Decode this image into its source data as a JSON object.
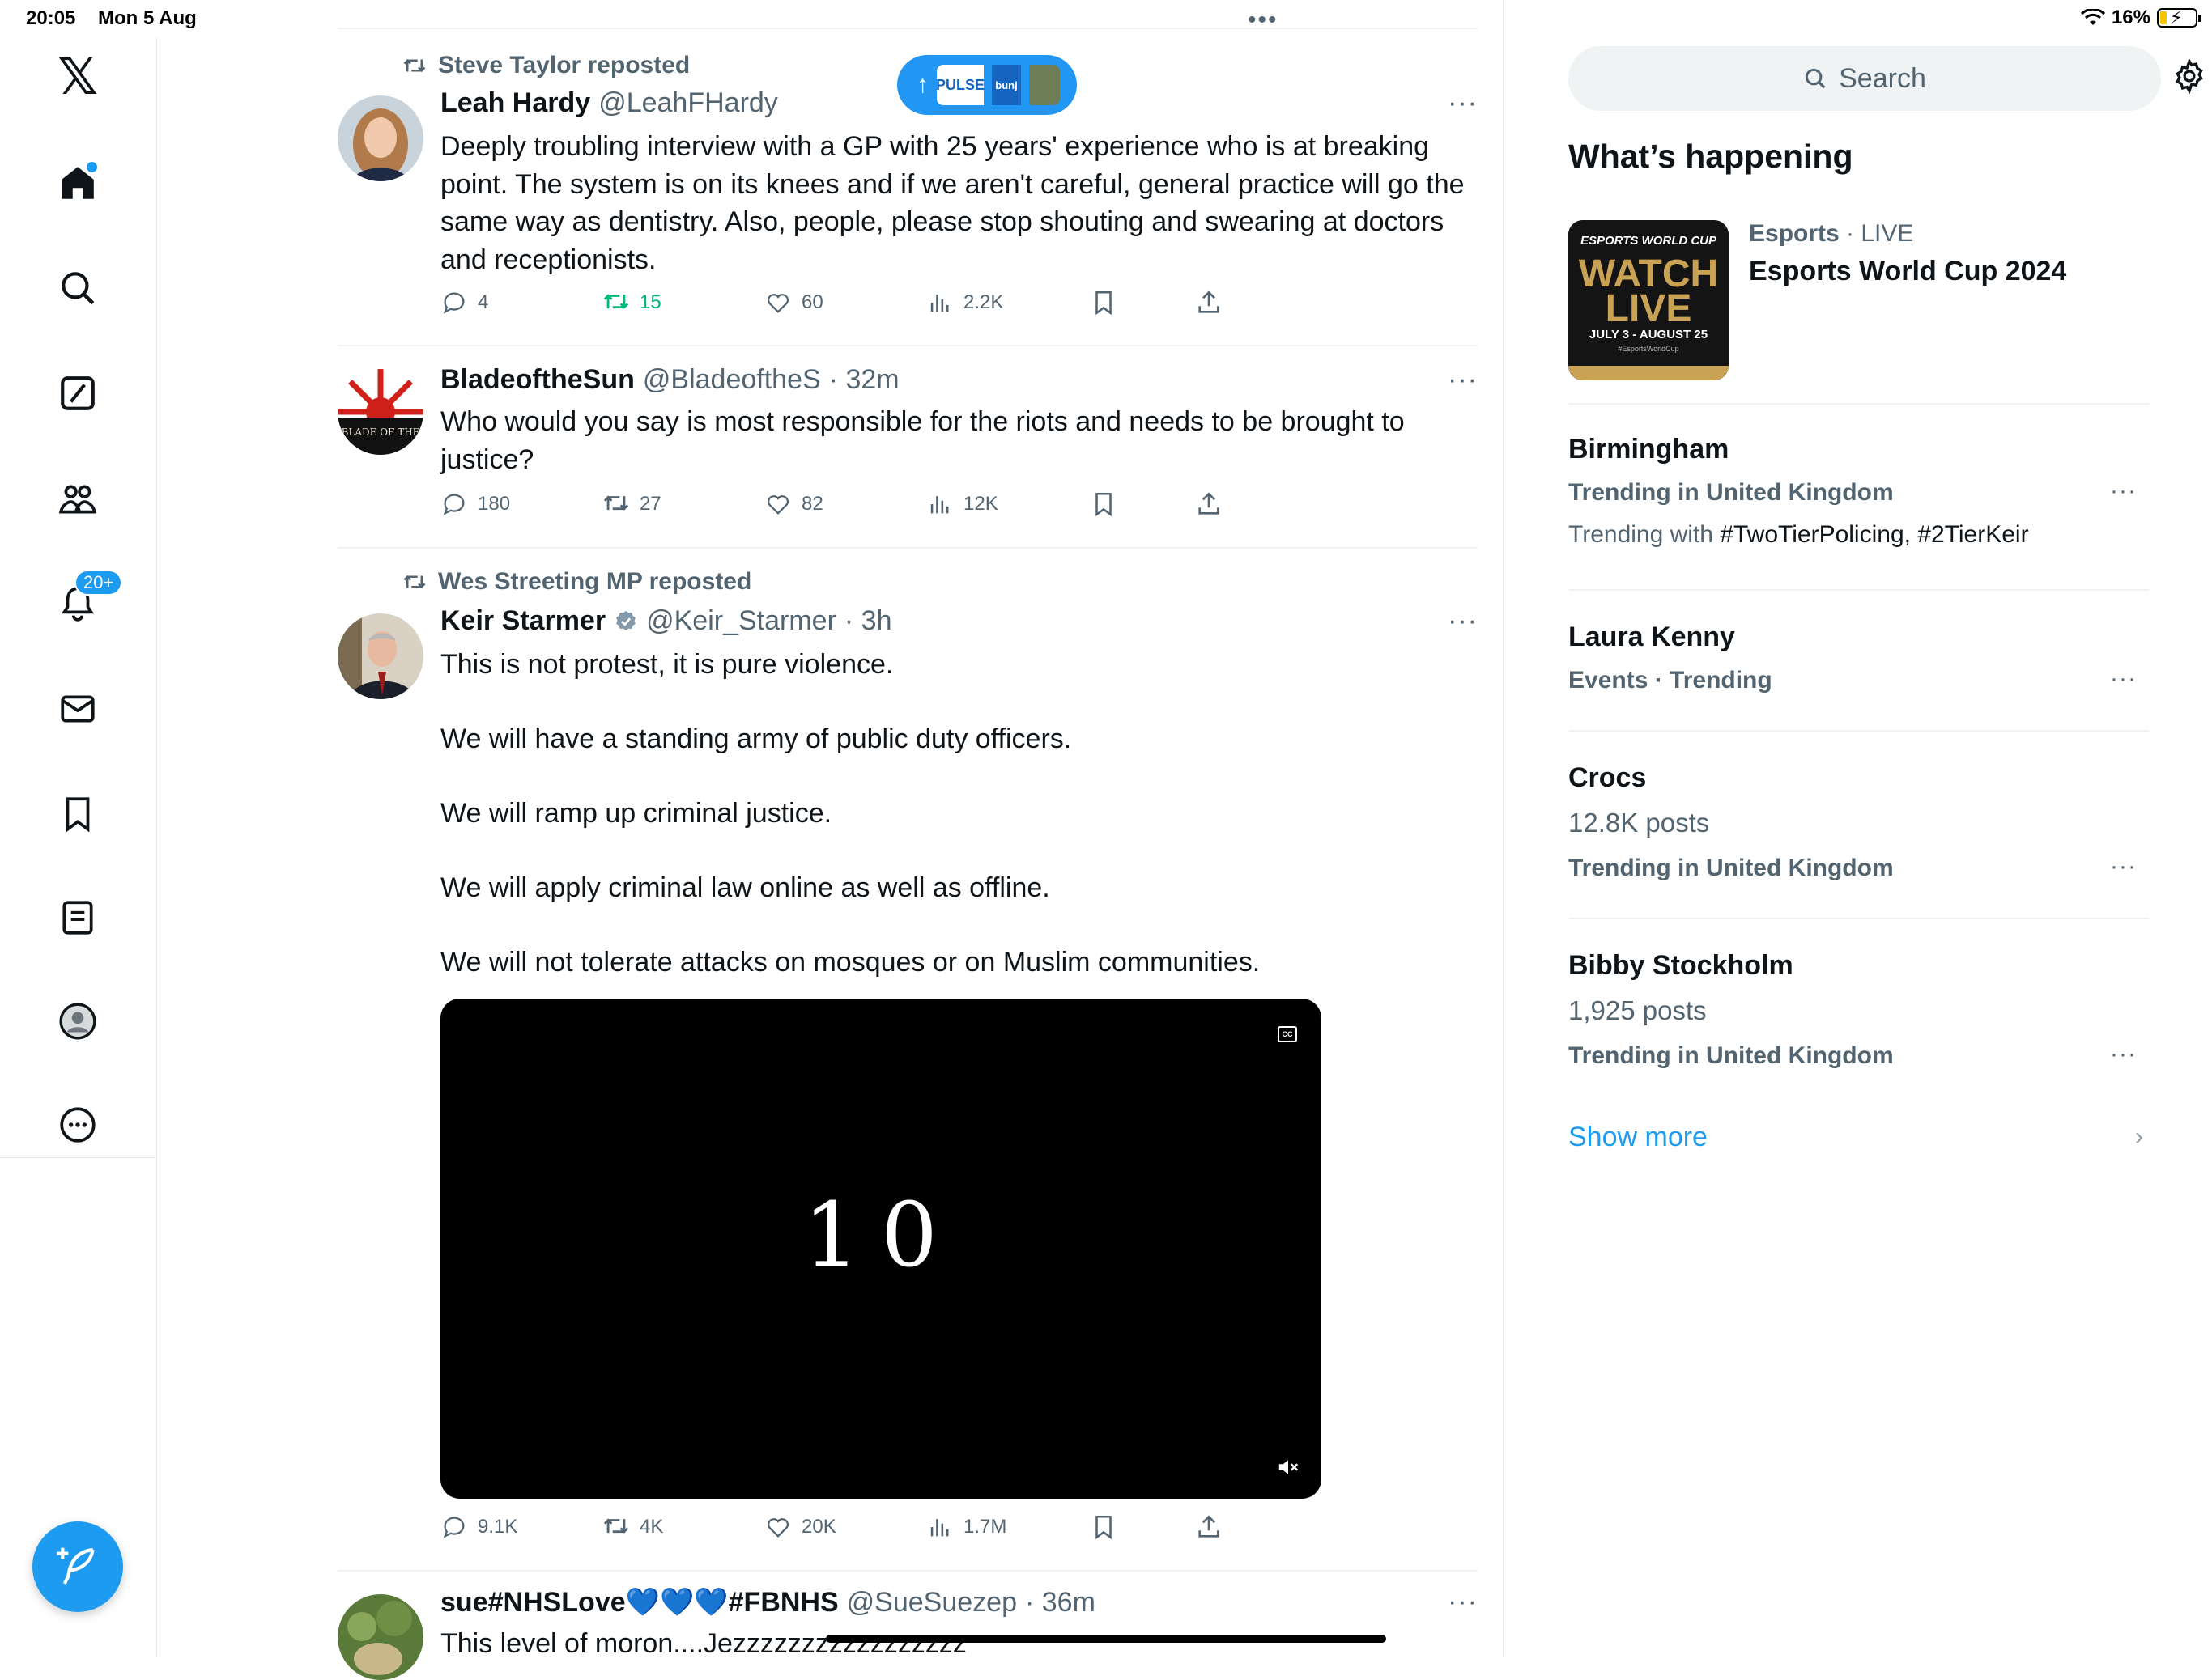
{
  "status_bar": {
    "time": "20:05",
    "date": "Mon 5 Aug",
    "battery": "16%"
  },
  "nav": {
    "logo": "𝕏",
    "notifications_badge": "20+",
    "items": [
      "home-icon",
      "search-icon",
      "grok-icon",
      "communities-icon",
      "notifications-icon",
      "messages-icon",
      "bookmarks-icon",
      "lists-icon",
      "profile-icon",
      "more-icon"
    ]
  },
  "pulse": {
    "arrow": "↑",
    "chip_a": "PULSE",
    "chip_b": "bunj"
  },
  "tweets": [
    {
      "repost_by": "Steve Taylor reposted",
      "name": "Leah Hardy",
      "handle": "@LeahFHardy",
      "time": "",
      "text": "Deeply troubling interview with a GP with 25 years' experience who is at breaking point. The system is on its knees and if we aren't careful, general practice will go the same way as dentistry. Also, people, please stop shouting and swearing at doctors and receptionists.",
      "replies": "4",
      "reposts": "15",
      "likes": "60",
      "views": "2.2K"
    },
    {
      "name": "BladeoftheSun",
      "handle": "@BladeoftheS",
      "time": "· 32m",
      "avatar_text": "BLADE OF THE",
      "text": "Who would you say is most responsible for the riots and needs to be brought to justice?",
      "replies": "180",
      "reposts": "27",
      "likes": "82",
      "views": "12K"
    },
    {
      "repost_by": "Wes Streeting MP reposted",
      "name": "Keir Starmer",
      "handle": "@Keir_Starmer",
      "time": "· 3h",
      "text": "This is not protest, it is pure violence.\n\nWe will have a standing army of public duty officers.\n\nWe will ramp up criminal justice.\n\nWe will apply criminal law online as well as offline.\n\nWe will not tolerate attacks on mosques or on Muslim communities.",
      "video_text": "10",
      "replies": "9.1K",
      "reposts": "4K",
      "likes": "20K",
      "views": "1.7M"
    },
    {
      "name": "sue#NHSLove💙💙💙#FBNHS",
      "handle": "@SueSuezep",
      "time": "· 36m",
      "text": "This level of moron....Jezzzzzzzzzzzzzzzzz"
    }
  ],
  "sidebar": {
    "search_placeholder": "Search",
    "whats_happening": "What’s happening",
    "esports": {
      "category": "Esports",
      "live": " · LIVE",
      "title": "Esports World Cup 2024",
      "thumb_line1": "ESPORTS WORLD CUP",
      "thumb_line2": "WATCH",
      "thumb_line3": "LIVE",
      "thumb_dates": "JULY 3 - AUGUST 25",
      "thumb_tag": "#EsportsWorldCup"
    },
    "trends": [
      {
        "title": "Birmingham",
        "context": "Trending in United Kingdom",
        "trending_with_label": "Trending with ",
        "trending_with": "#TwoTierPolicing, #2TierKeir"
      },
      {
        "title": "Laura Kenny",
        "context": "Events · Trending"
      },
      {
        "title": "Crocs",
        "posts": "12.8K posts",
        "context": "Trending in United Kingdom"
      },
      {
        "title": "Bibby Stockholm",
        "posts": "1,925 posts",
        "context": "Trending in United Kingdom"
      }
    ],
    "show_more": "Show more"
  },
  "colors": {
    "accent": "#1d9bf0",
    "repost_green": "#00ba7c",
    "muted": "#536471"
  }
}
